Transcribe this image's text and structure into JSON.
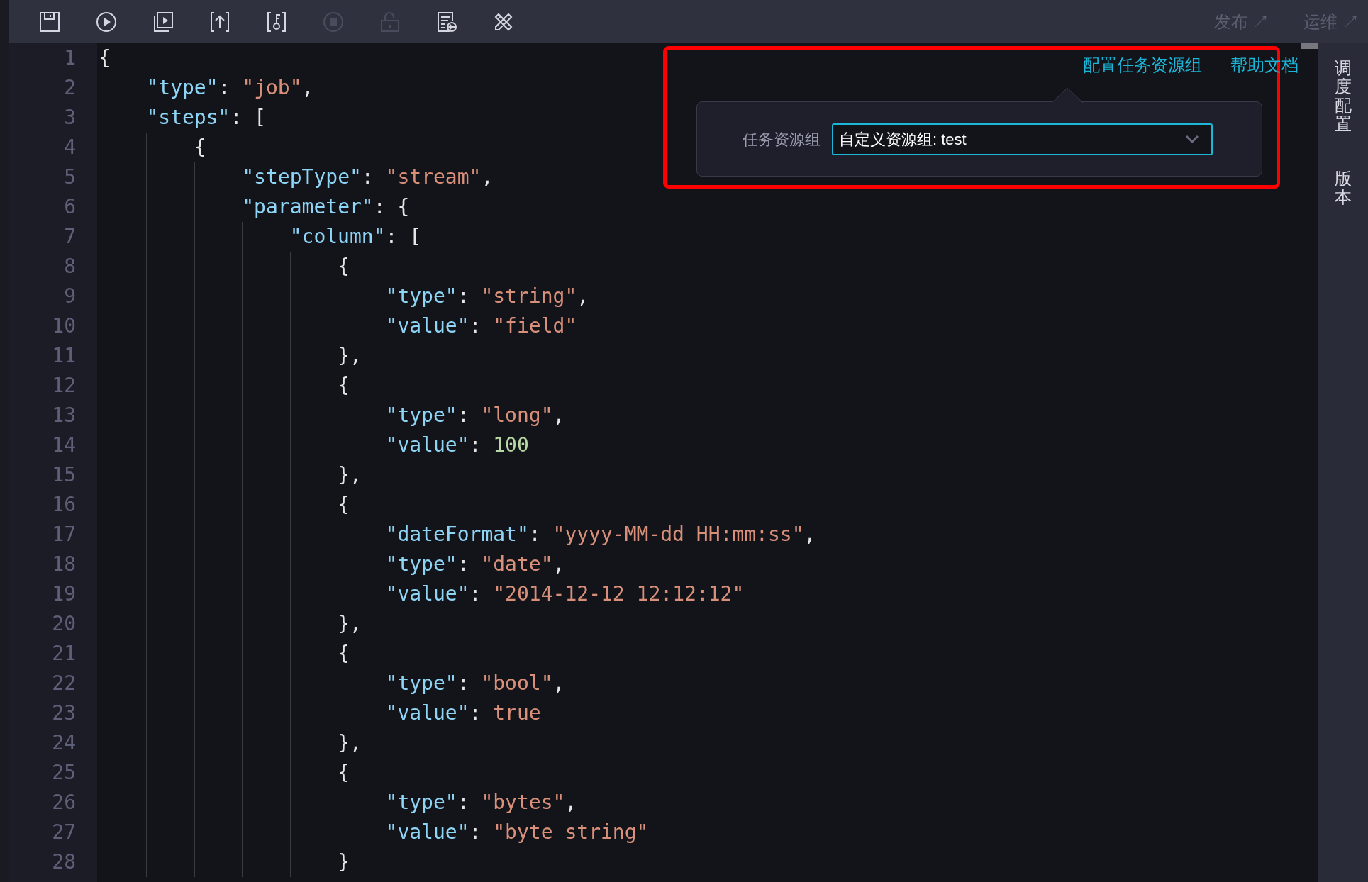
{
  "toolbar": {
    "icons": [
      {
        "kind": "save",
        "disabled": false
      },
      {
        "kind": "run",
        "disabled": false
      },
      {
        "kind": "run-batch",
        "disabled": false
      },
      {
        "kind": "submit",
        "disabled": false
      },
      {
        "kind": "key",
        "disabled": false
      },
      {
        "kind": "stop",
        "disabled": true
      },
      {
        "kind": "lock",
        "disabled": true
      },
      {
        "kind": "import",
        "disabled": false
      },
      {
        "kind": "tools",
        "disabled": false
      }
    ],
    "links": [
      "发布 ↗",
      "运维 ↗"
    ]
  },
  "editor": {
    "lines": [
      {
        "number": "1",
        "text": "{"
      },
      {
        "number": "2",
        "text": "    \"type\": \"job\","
      },
      {
        "number": "3",
        "text": "    \"steps\": ["
      },
      {
        "number": "4",
        "text": "        {"
      },
      {
        "number": "5",
        "text": "            \"stepType\": \"stream\","
      },
      {
        "number": "6",
        "text": "            \"parameter\": {"
      },
      {
        "number": "7",
        "text": "                \"column\": ["
      },
      {
        "number": "8",
        "text": "                    {"
      },
      {
        "number": "9",
        "text": "                        \"type\": \"string\","
      },
      {
        "number": "10",
        "text": "                        \"value\": \"field\""
      },
      {
        "number": "11",
        "text": "                    },"
      },
      {
        "number": "12",
        "text": "                    {"
      },
      {
        "number": "13",
        "text": "                        \"type\": \"long\","
      },
      {
        "number": "14",
        "text": "                        \"value\": 100"
      },
      {
        "number": "15",
        "text": "                    },"
      },
      {
        "number": "16",
        "text": "                    {"
      },
      {
        "number": "17",
        "text": "                        \"dateFormat\": \"yyyy-MM-dd HH:mm:ss\","
      },
      {
        "number": "18",
        "text": "                        \"type\": \"date\","
      },
      {
        "number": "19",
        "text": "                        \"value\": \"2014-12-12 12:12:12\""
      },
      {
        "number": "20",
        "text": "                    },"
      },
      {
        "number": "21",
        "text": "                    {"
      },
      {
        "number": "22",
        "text": "                        \"type\": \"bool\","
      },
      {
        "number": "23",
        "text": "                        \"value\": true"
      },
      {
        "number": "24",
        "text": "                    },"
      },
      {
        "number": "25",
        "text": "                    {"
      },
      {
        "number": "26",
        "text": "                        \"type\": \"bytes\","
      },
      {
        "number": "27",
        "text": "                        \"value\": \"byte string\""
      },
      {
        "number": "28",
        "text": "                    }"
      }
    ]
  },
  "popover": {
    "links": [
      "配置任务资源组",
      "帮助文档"
    ],
    "label": "任务资源组",
    "value": "自定义资源组: test"
  },
  "sidebar": {
    "tabs": [
      "调度配置",
      "版本"
    ]
  }
}
